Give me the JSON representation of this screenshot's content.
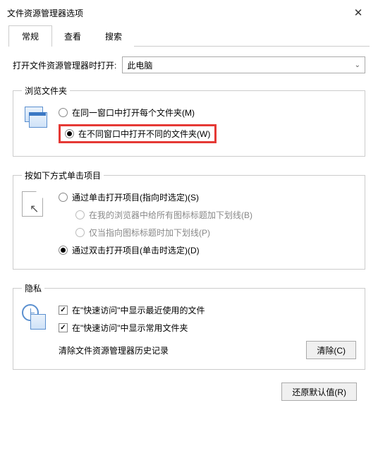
{
  "window": {
    "title": "文件资源管理器选项"
  },
  "tabs": {
    "general": "常规",
    "view": "查看",
    "search": "搜索"
  },
  "openRow": {
    "label": "打开文件资源管理器时打开:",
    "value": "此电脑"
  },
  "browse": {
    "legend": "浏览文件夹",
    "sameWindow": "在同一窗口中打开每个文件夹(M)",
    "newWindow": "在不同窗口中打开不同的文件夹(W)"
  },
  "click": {
    "legend": "按如下方式单击项目",
    "single": "通过单击打开项目(指向时选定)(S)",
    "underlineAll": "在我的浏览器中给所有图标标题加下划线(B)",
    "underlinePoint": "仅当指向图标标题时加下划线(P)",
    "double": "通过双击打开项目(单击时选定)(D)"
  },
  "privacy": {
    "legend": "隐私",
    "recentFiles": "在\"快速访问\"中显示最近使用的文件",
    "frequentFolders": "在\"快速访问\"中显示常用文件夹",
    "clearLabel": "清除文件资源管理器历史记录",
    "clearBtn": "清除(C)"
  },
  "restore": "还原默认值(R)"
}
